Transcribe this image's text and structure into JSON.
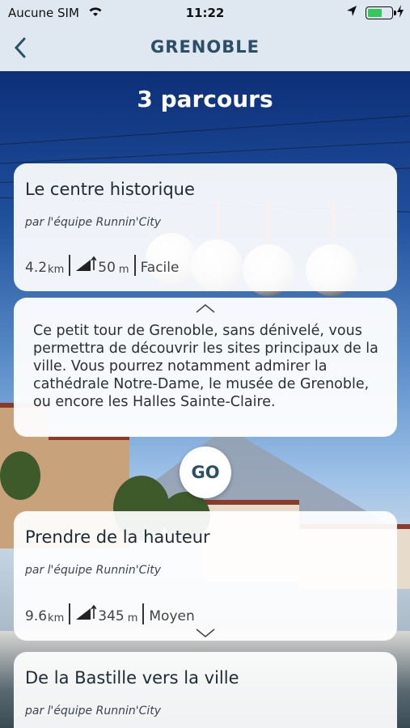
{
  "status": {
    "carrier": "Aucune SIM",
    "time": "11:22",
    "battery_level": 0.6
  },
  "nav": {
    "title": "GRENOBLE"
  },
  "header": {
    "count": "3 parcours"
  },
  "routes": [
    {
      "name": "Le centre historique",
      "by": "par l'équipe Runnin'City",
      "distance": "4.2",
      "distance_unit": "km",
      "elevation": "50",
      "elevation_unit": "m",
      "difficulty": "Facile",
      "description": "Ce petit tour de Grenoble, sans dénivelé, vous permettra de découvrir les sites principaux de la ville. Vous pourrez notamment admirer la cathédrale Notre-Dame, le musée de Grenoble, ou encore les Halles Sainte-Claire."
    },
    {
      "name": "Prendre de la hauteur",
      "by": "par l'équipe Runnin'City",
      "distance": "9.6",
      "distance_unit": "km",
      "elevation": "345",
      "elevation_unit": "m",
      "difficulty": "Moyen"
    },
    {
      "name": "De la Bastille vers la ville",
      "by": "par l'équipe Runnin'City"
    }
  ],
  "go_label": "GO",
  "colors": {
    "accent": "#2b4f66",
    "navbar_bg": "#dfe7f1",
    "battery": "#34c759"
  }
}
